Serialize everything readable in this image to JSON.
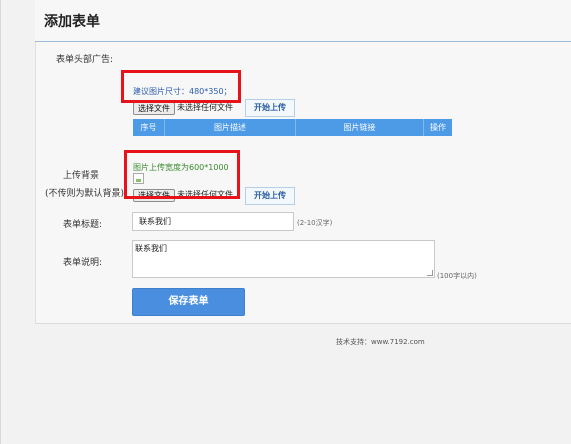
{
  "header": {
    "title": "添加表单"
  },
  "form": {
    "head_ad_label": "表单头部广告:",
    "head_ad_hint": "建议图片尺寸：480*350；",
    "file_button": "选择文件",
    "file_none": "未选择任何文件",
    "upload_button": "开始上传",
    "table_headers": [
      "序号",
      "图片描述",
      "图片链接",
      "操作"
    ],
    "bg_label": "上传背景",
    "bg_label_sub": "(不传则为默认背景)",
    "bg_hint": "图片上传宽度为600*1000",
    "title_label": "表单标题:",
    "title_value": "联系我们",
    "title_note": "(2-10汉字)",
    "desc_label": "表单说明:",
    "desc_value": "联系我们",
    "desc_note": "(100字以内)",
    "save_button": "保存表单"
  },
  "footer": {
    "text": "技术支持：www.7192.com"
  },
  "colors": {
    "accent": "#4a8fdf",
    "table_header": "#4d9be6",
    "highlight": "#e8131a"
  }
}
